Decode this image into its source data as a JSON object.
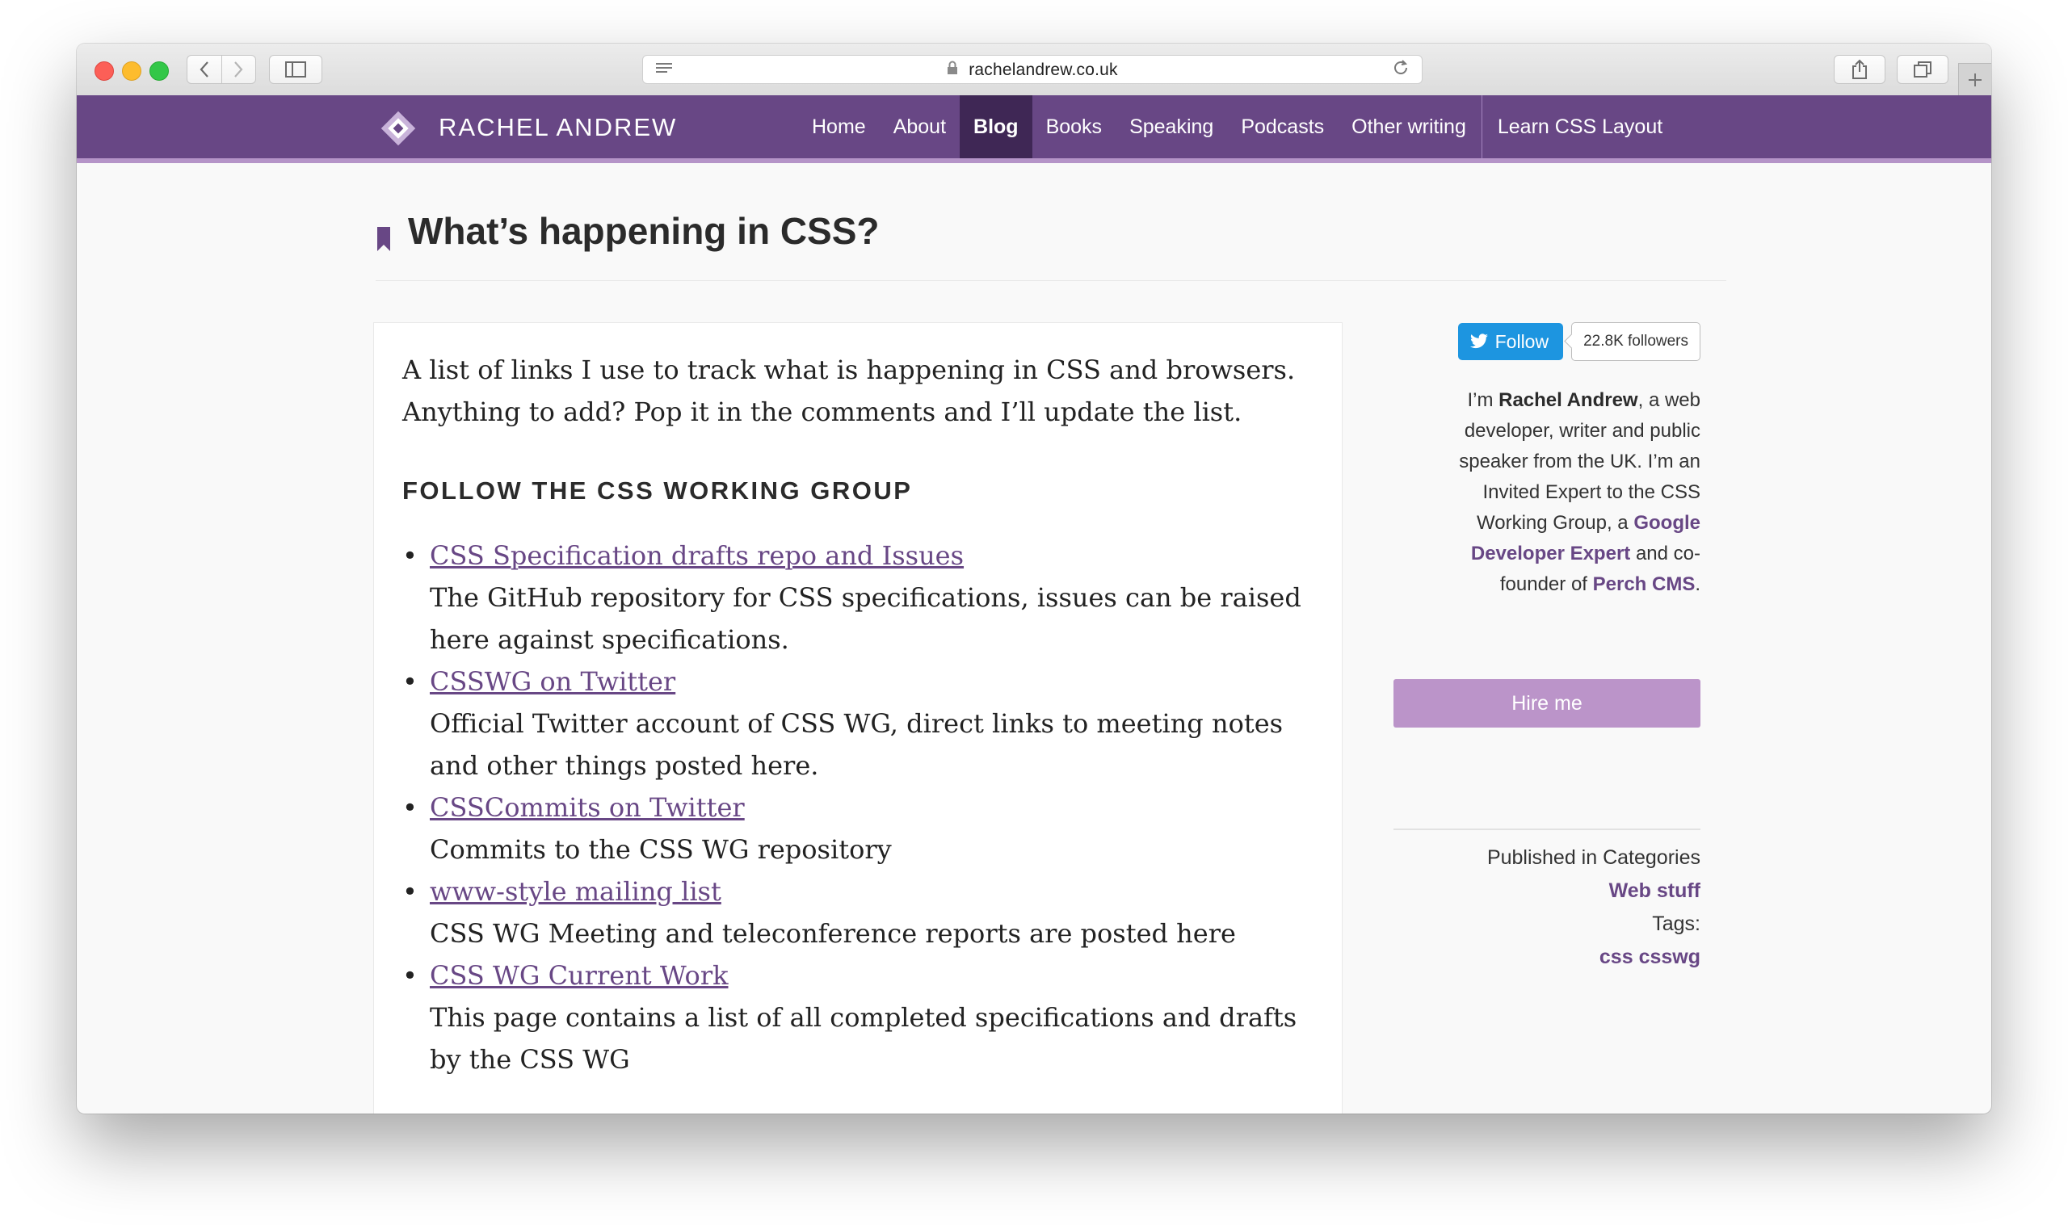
{
  "browser": {
    "url": "rachelandrew.co.uk"
  },
  "site": {
    "logo_text": "RACHEL ANDREW",
    "nav": [
      {
        "label": "Home"
      },
      {
        "label": "About"
      },
      {
        "label": "Blog"
      },
      {
        "label": "Books"
      },
      {
        "label": "Speaking"
      },
      {
        "label": "Podcasts"
      },
      {
        "label": "Other writing"
      }
    ],
    "nav_extra": "Learn CSS Layout",
    "active_nav": "Blog"
  },
  "post": {
    "title": "What’s happening in CSS?",
    "intro": "A list of links I use to track what is happening in CSS and browsers. Anything to add? Pop it in the comments and I’ll update the list.",
    "section_heading": "FOLLOW THE CSS WORKING GROUP",
    "links": [
      {
        "title": "CSS Specification drafts repo and Issues",
        "desc": "The GitHub repository for CSS specifications, issues can be raised here against specifications."
      },
      {
        "title": "CSSWG on Twitter",
        "desc": "Official Twitter account of CSS WG, direct links to meeting notes and other things posted here."
      },
      {
        "title": "CSSCommits on Twitter",
        "desc": "Commits to the CSS WG repository"
      },
      {
        "title": "www-style mailing list",
        "desc": "CSS WG Meeting and teleconference reports are posted here"
      },
      {
        "title": "CSS WG Current Work",
        "desc": "This page contains a list of all completed specifications and drafts by the CSS WG"
      }
    ]
  },
  "sidebar": {
    "follow_label": "Follow",
    "followers": "22.8K followers",
    "bio": {
      "p1": "I’m ",
      "name": "Rachel Andrew",
      "p2": ", a web developer, writer and public speaker from the UK. I’m an Invited Expert to the CSS Working Group, a ",
      "gde": "Google Developer Expert",
      "p3": " and co-founder of ",
      "perch": "Perch CMS",
      "p4": "."
    },
    "hire_label": "Hire me",
    "published_label": "Published in Categories",
    "category": "Web stuff",
    "tags_label": "Tags:",
    "tags": [
      "css",
      "csswg"
    ]
  },
  "colors": {
    "brand": "#684785",
    "active_nav_bg": "#3f2755",
    "link": "#684785",
    "hire_button": "#bb94c9",
    "twitter": "#1d95e0"
  }
}
